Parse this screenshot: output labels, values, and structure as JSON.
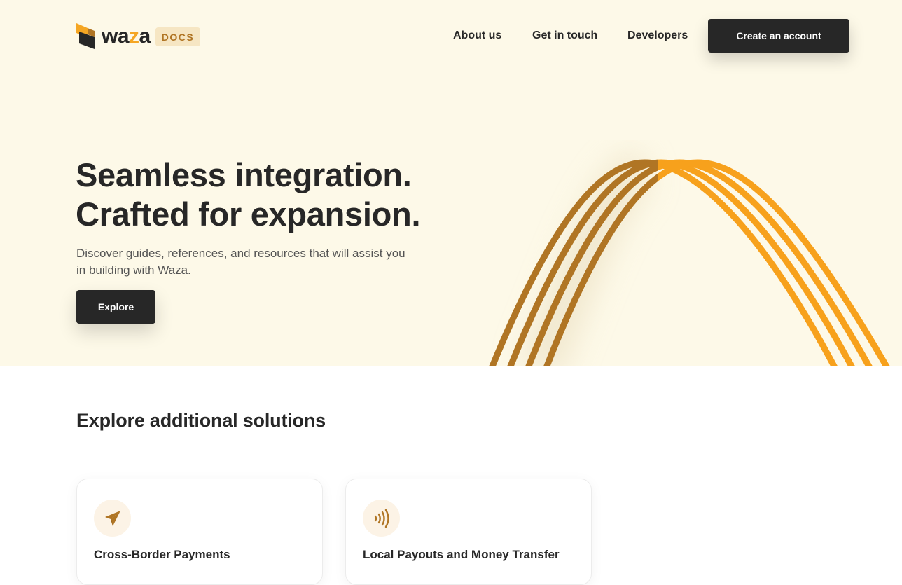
{
  "brand": {
    "name_prefix": "wa",
    "name_z": "z",
    "name_suffix": "a",
    "badge": "DOCS"
  },
  "nav": {
    "items": [
      {
        "label": "About us"
      },
      {
        "label": "Get in touch"
      },
      {
        "label": "Developers"
      }
    ],
    "cta_label": "Create an account"
  },
  "hero": {
    "headline_line1": "Seamless integration.",
    "headline_line2": "Crafted for expansion.",
    "subtext": "Discover guides, references, and resources that will assist you in building with Waza.",
    "button_label": "Explore"
  },
  "solutions": {
    "title": "Explore additional solutions",
    "cards": [
      {
        "title": "Cross-Border Payments",
        "icon": "paper-plane-icon"
      },
      {
        "title": "Local Payouts and Money Transfer",
        "icon": "contactless-icon"
      }
    ]
  },
  "colors": {
    "accent": "#f5a623",
    "accent_dark": "#b07524",
    "hero_bg": "#fdf9e8",
    "ink": "#272727"
  }
}
